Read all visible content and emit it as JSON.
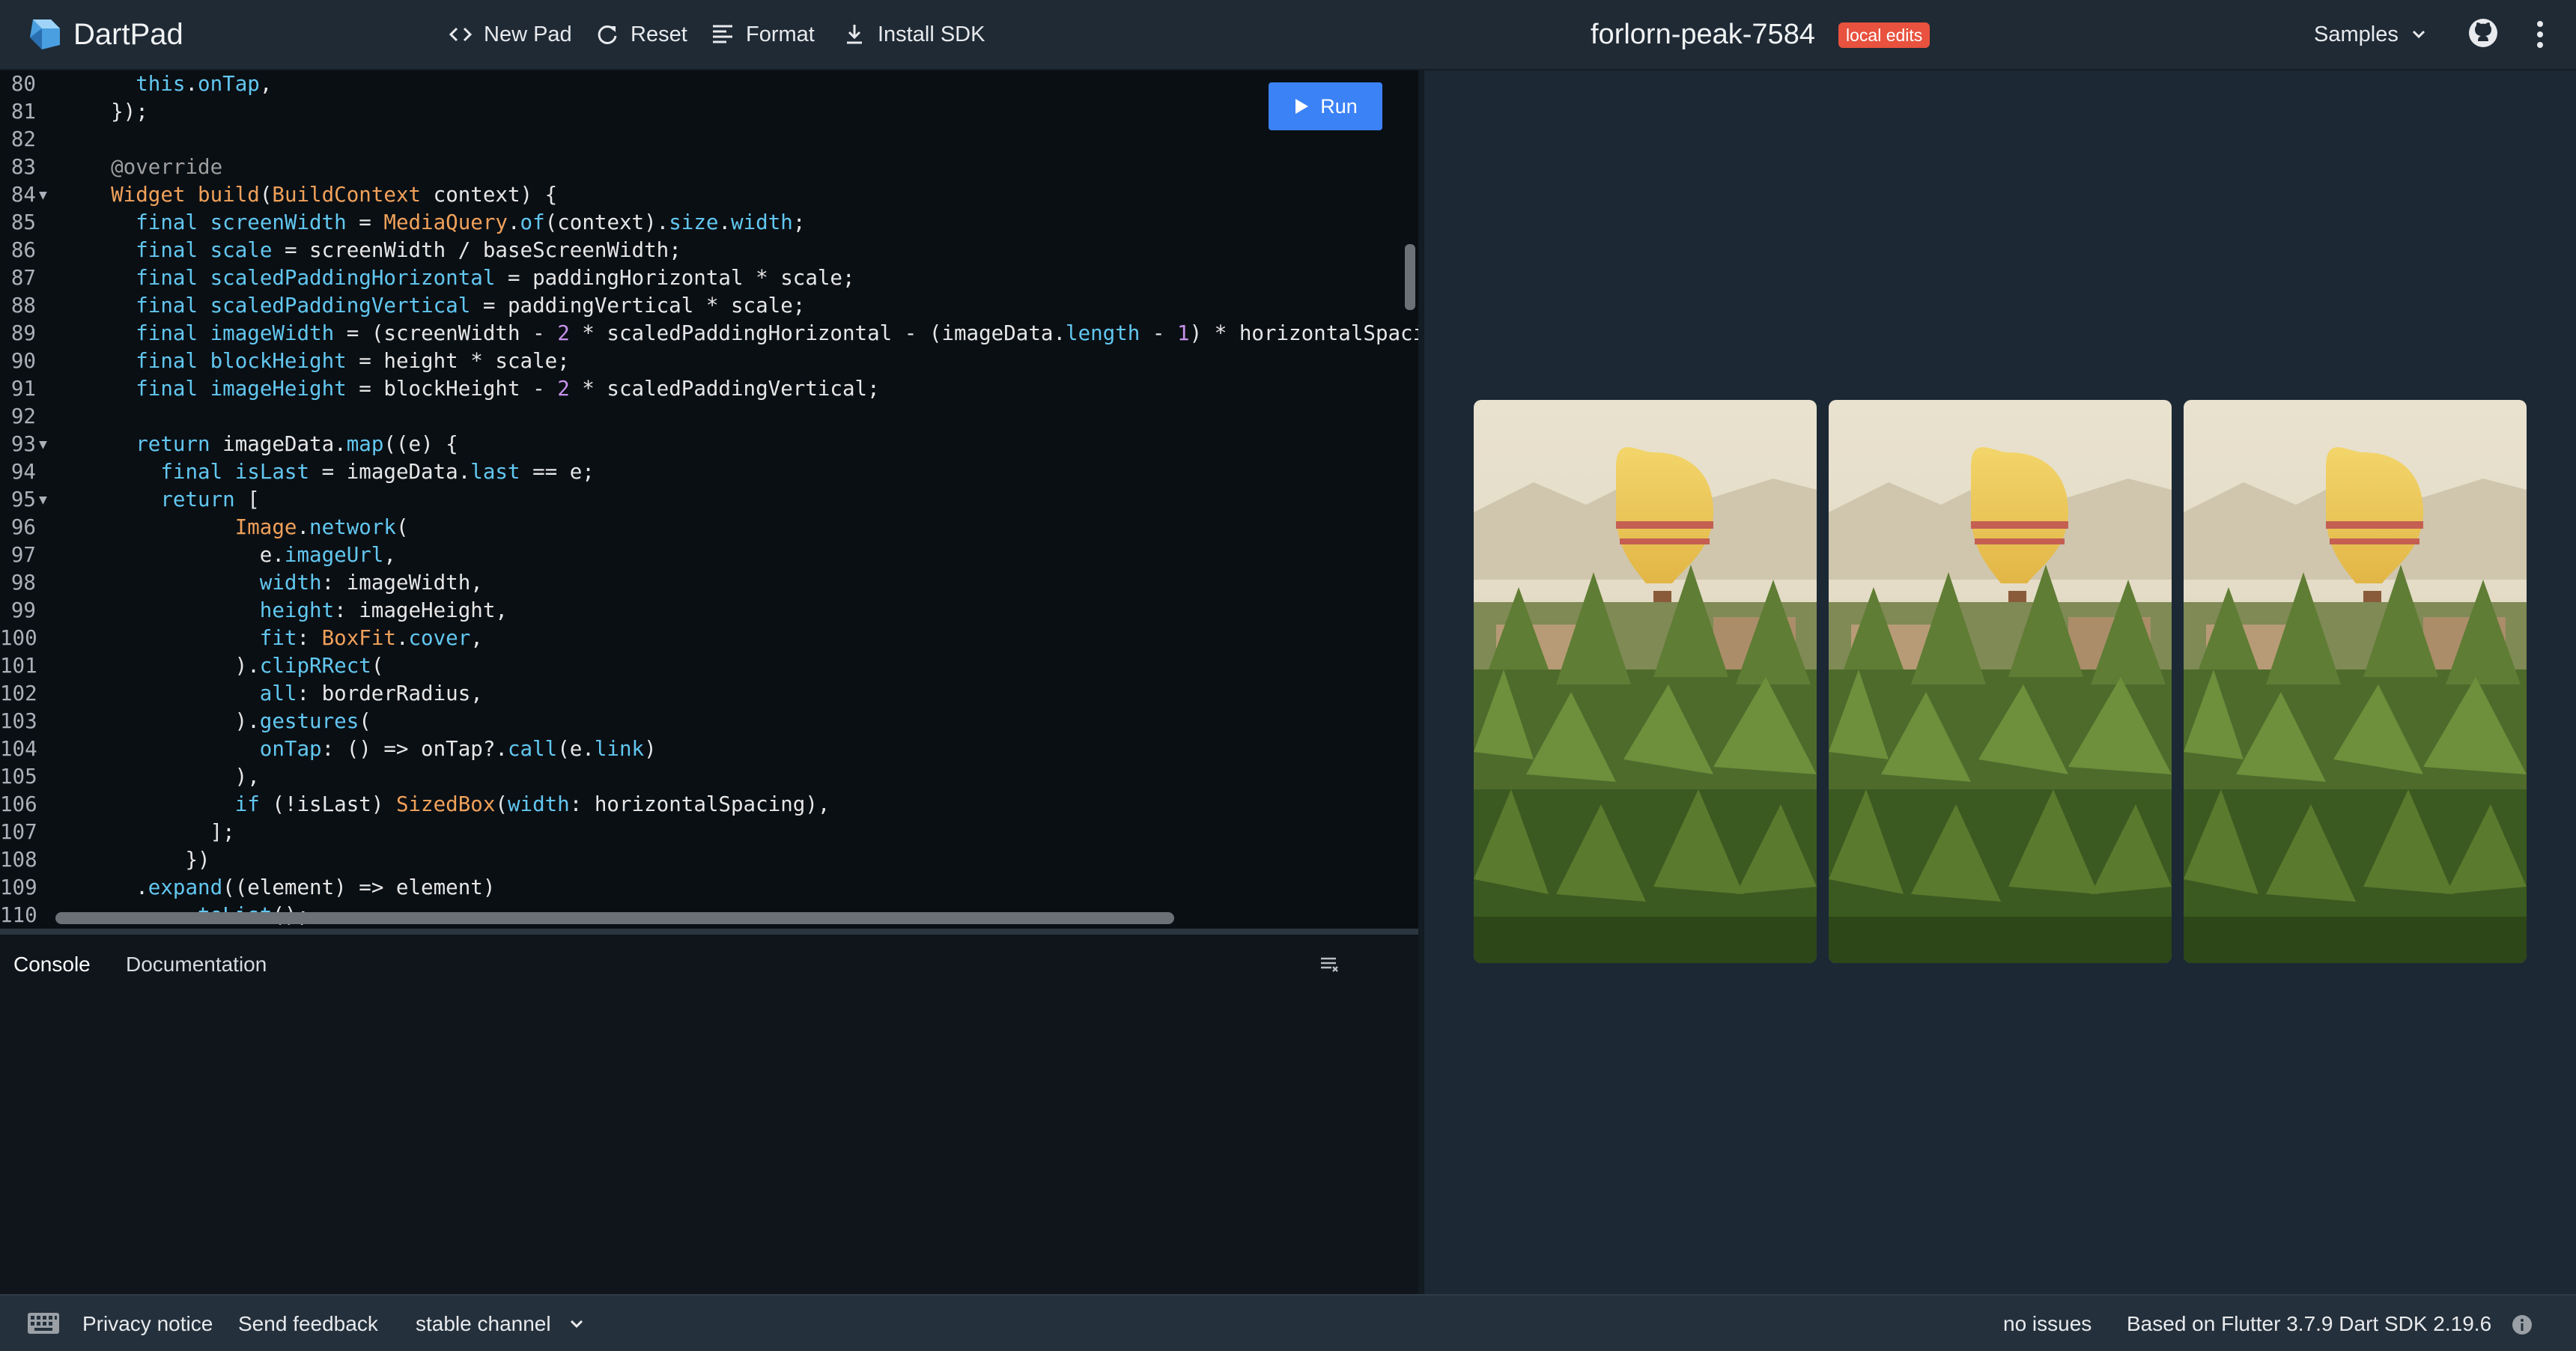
{
  "app": {
    "name": "DartPad",
    "pad_name": "forlorn-peak-7584",
    "badge": "local edits"
  },
  "toolbar": {
    "new_pad": "New Pad",
    "reset": "Reset",
    "format": "Format",
    "install_sdk": "Install SDK",
    "samples": "Samples"
  },
  "editor": {
    "run_label": "Run",
    "lines": [
      {
        "n": "80",
        "code": "    this.onTap,"
      },
      {
        "n": "81",
        "code": "  });"
      },
      {
        "n": "82",
        "code": ""
      },
      {
        "n": "83",
        "code": "  @override"
      },
      {
        "n": "84",
        "fold": true,
        "code": "  Widget build(BuildContext context) {"
      },
      {
        "n": "85",
        "code": "    final screenWidth = MediaQuery.of(context).size.width;"
      },
      {
        "n": "86",
        "code": "    final scale = screenWidth / baseScreenWidth;"
      },
      {
        "n": "87",
        "code": "    final scaledPaddingHorizontal = paddingHorizontal * scale;"
      },
      {
        "n": "88",
        "code": "    final scaledPaddingVertical = paddingVertical * scale;"
      },
      {
        "n": "89",
        "code": "    final imageWidth = (screenWidth - 2 * scaledPaddingHorizontal - (imageData.length - 1) * horizontalSpaci"
      },
      {
        "n": "90",
        "code": "    final blockHeight = height * scale;"
      },
      {
        "n": "91",
        "code": "    final imageHeight = blockHeight - 2 * scaledPaddingVertical;"
      },
      {
        "n": "92",
        "code": ""
      },
      {
        "n": "93",
        "fold": true,
        "code": "    return imageData.map((e) {"
      },
      {
        "n": "94",
        "code": "      final isLast = imageData.last == e;"
      },
      {
        "n": "95",
        "fold": true,
        "code": "      return ["
      },
      {
        "n": "96",
        "code": "            Image.network("
      },
      {
        "n": "97",
        "code": "              e.imageUrl,"
      },
      {
        "n": "98",
        "code": "              width: imageWidth,"
      },
      {
        "n": "99",
        "code": "              height: imageHeight,"
      },
      {
        "n": "100",
        "code": "              fit: BoxFit.cover,"
      },
      {
        "n": "101",
        "code": "            ).clipRRect("
      },
      {
        "n": "102",
        "code": "              all: borderRadius,"
      },
      {
        "n": "103",
        "code": "            ).gestures("
      },
      {
        "n": "104",
        "code": "              onTap: () => onTap?.call(e.link)"
      },
      {
        "n": "105",
        "code": "            ),"
      },
      {
        "n": "106",
        "code": "            if (!isLast) SizedBox(width: horizontalSpacing),"
      },
      {
        "n": "107",
        "code": "          ];"
      },
      {
        "n": "108",
        "code": "        })"
      },
      {
        "n": "109",
        "code": "    .expand((element) => element)"
      },
      {
        "n": "110",
        "code": "        .toList();"
      }
    ]
  },
  "console": {
    "tab_console": "Console",
    "tab_docs": "Documentation"
  },
  "output": {
    "images": 3
  },
  "status": {
    "privacy": "Privacy notice",
    "feedback": "Send feedback",
    "channel": "stable channel",
    "issues": "no issues",
    "version": "Based on Flutter 3.7.9 Dart SDK 2.19.6"
  },
  "colors": {
    "run_button": "#3b82f6",
    "badge": "#e8523e",
    "editor_bg": "#0a0f14",
    "app_bg": "#1c2834"
  },
  "icons": [
    "dart-logo-icon",
    "code-icon",
    "reset-icon",
    "format-icon",
    "download-icon",
    "chevron-down-icon",
    "github-icon",
    "more-vert-icon",
    "play-icon",
    "clear-console-icon",
    "keyboard-icon",
    "info-icon"
  ]
}
